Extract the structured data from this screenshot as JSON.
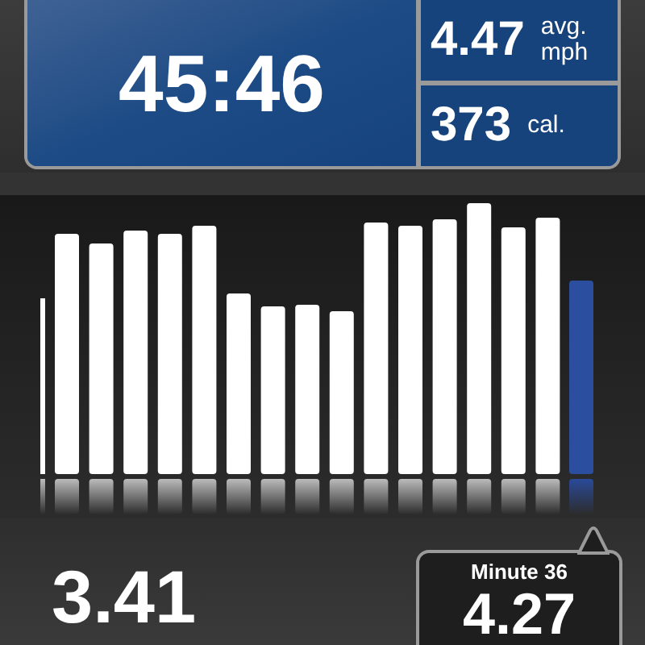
{
  "timer": {
    "elapsed": "45:46"
  },
  "stats": [
    {
      "value": "4.47",
      "unit": [
        "avg.",
        "mph"
      ]
    },
    {
      "value": "373",
      "unit": [
        "cal."
      ]
    }
  ],
  "summary": {
    "value": "3.41"
  },
  "callout": {
    "label": "Minute 36",
    "value": "4.27"
  }
}
